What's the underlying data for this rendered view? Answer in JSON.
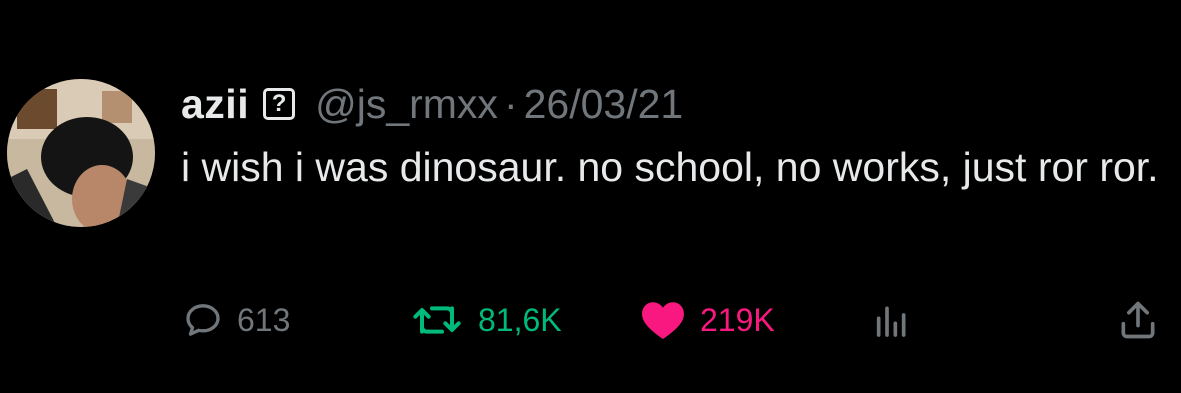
{
  "tweet": {
    "display_name": "azii",
    "label_glyph": "?",
    "handle": "@js_rmxx",
    "separator": "·",
    "date": "26/03/21",
    "text": "i wish i was dinosaur. no school, no works, just ror ror."
  },
  "actions": {
    "replies": "613",
    "retweets": "81,6K",
    "likes": "219K"
  },
  "icons": {
    "reply": "reply-icon",
    "retweet": "retweet-icon",
    "like": "heart-icon",
    "views": "analytics-icon",
    "share": "share-icon"
  },
  "colors": {
    "background": "#000000",
    "primary_text": "#e7e9ea",
    "secondary_text": "#71767b",
    "retweet": "#00ba7c",
    "like": "#f91880"
  }
}
